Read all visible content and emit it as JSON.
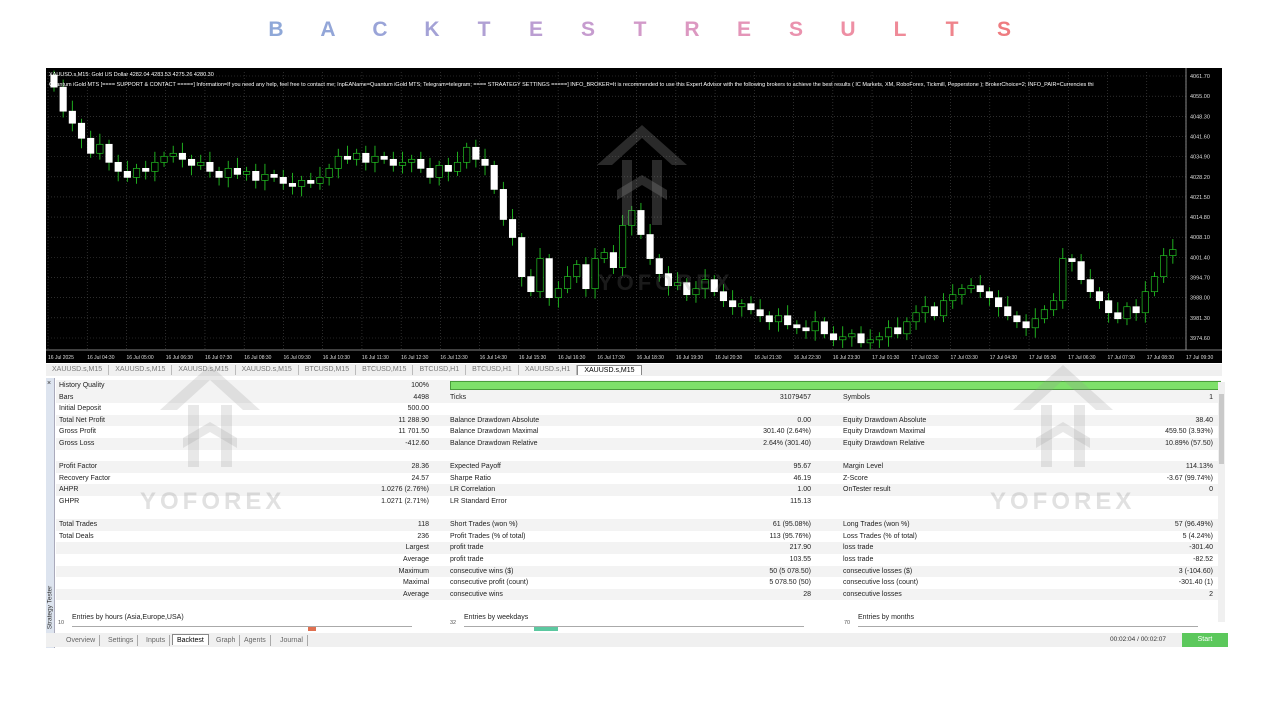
{
  "title": {
    "letters": [
      "B",
      "A",
      "C",
      "K",
      "T",
      "E",
      "S",
      "T",
      "R",
      "E",
      "S",
      "U",
      "L",
      "T",
      "S"
    ],
    "colors": [
      "#8fa8d8",
      "#93a6d8",
      "#9aa4d8",
      "#a4a2d6",
      "#b0a0d4",
      "#bb9ed2",
      "#c69ccf",
      "#d29ac9",
      "#dc98c1",
      "#e495b8",
      "#ea92ae",
      "#ee8fa4",
      "#ef8a98",
      "#ef848c",
      "#ee7c80"
    ]
  },
  "chart": {
    "header_line1": "XAUUSD.s,M15:  Gold US Dollar  4282.04 4283.53 4275.26 4280.30",
    "header_line2": "Quantum iGold MTS [==== SUPPORT & CONTACT =====] Information=If you need any help, feel free to contact me; InpEAName=Quantum iGold MTS; Telegram=telegram; ==== STRAATEGY SETTINGS =====] INFO_BROKER=It is recommended to use this Expert Advisor with the following brokers to achieve the best results ( IC Markets, XM, RoboForex, Tickmill, Pepperstone ); BrokerChoice=2; INFO_PAIR=Currencies thi",
    "price_labels": [
      "4061.70",
      "4055.00",
      "4048.30",
      "4041.60",
      "4034.90",
      "4028.20",
      "4021.50",
      "4014.80",
      "4008.10",
      "4001.40",
      "3994.70",
      "3988.00",
      "3981.30",
      "3974.60"
    ],
    "time_labels": [
      "16 Jul 2025",
      "16 Jul 04:30",
      "16 Jul 05:00",
      "16 Jul 06:30",
      "16 Jul 07:30",
      "16 Jul 08:30",
      "16 Jul 09:30",
      "16 Jul 10:30",
      "16 Jul 11:30",
      "16 Jul 12:30",
      "16 Jul 13:30",
      "16 Jul 14:30",
      "16 Jul 15:30",
      "16 Jul 16:30",
      "16 Jul 17:30",
      "16 Jul 18:30",
      "16 Jul 19:30",
      "16 Jul 20:30",
      "16 Jul 21:30",
      "16 Jul 22:30",
      "16 Jul 23:30",
      "17 Jul 01:30",
      "17 Jul 02:30",
      "17 Jul 03:30",
      "17 Jul 04:30",
      "17 Jul 05:30",
      "17 Jul 06:30",
      "17 Jul 07:30",
      "17 Jul 08:30",
      "17 Jul 09:30"
    ],
    "closes": [
      4058,
      4050,
      4046,
      4041,
      4036,
      4039,
      4033,
      4030,
      4028,
      4031,
      4030,
      4033,
      4035,
      4036,
      4034,
      4032,
      4033,
      4030,
      4028,
      4031,
      4029,
      4030,
      4027,
      4029,
      4028,
      4026,
      4025,
      4027,
      4026,
      4028,
      4031,
      4035,
      4034,
      4036,
      4033,
      4035,
      4034,
      4032,
      4033,
      4034,
      4031,
      4028,
      4032,
      4030,
      4033,
      4038,
      4034,
      4032,
      4024,
      4014,
      4008,
      3995,
      3990,
      4001,
      3988,
      3991,
      3995,
      3999,
      3991,
      4001,
      4003,
      3998,
      4012,
      4017,
      4009,
      4001,
      3996,
      3992,
      3993,
      3989,
      3991,
      3994,
      3990,
      3987,
      3985,
      3986,
      3984,
      3982,
      3980,
      3982,
      3979,
      3978,
      3977,
      3980,
      3976,
      3974,
      3975,
      3976,
      3973,
      3974,
      3975,
      3978,
      3976,
      3980,
      3983,
      3985,
      3982,
      3987,
      3989,
      3991,
      3992,
      3990,
      3988,
      3985,
      3982,
      3980,
      3978,
      3981,
      3984,
      3987,
      4001,
      4000,
      3994,
      3990,
      3987,
      3983,
      3981,
      3985,
      3983,
      3990,
      3995,
      4002,
      4004
    ]
  },
  "chart_tabs": [
    "XAUUSD.s,M15",
    "XAUUSD.s,M15",
    "XAUUSD.s,M15",
    "XAUUSD.s,M15",
    "BTCUSD,M15",
    "BTCUSD,M15",
    "BTCUSD,H1",
    "BTCUSD,H1",
    "XAUUSD.s,H1",
    "XAUUSD.s,M15"
  ],
  "report": {
    "rows": [
      {
        "shade": true,
        "a_label": "History Quality",
        "a_val": "100%",
        "b_label": "",
        "b_val": "",
        "c_label": "",
        "c_val": ""
      },
      {
        "shade": true,
        "a_label": "Bars",
        "a_val": "4498",
        "b_label": "Ticks",
        "b_val": "31079457",
        "c_label": "Symbols",
        "c_val": "1"
      },
      {
        "shade": false,
        "a_label": "Initial Deposit",
        "a_val": "500.00",
        "b_label": "",
        "b_val": "",
        "c_label": "",
        "c_val": ""
      },
      {
        "shade": true,
        "a_label": "Total Net Profit",
        "a_val": "11 288.90",
        "b_label": "Balance Drawdown Absolute",
        "b_val": "0.00",
        "c_label": "Equity Drawdown Absolute",
        "c_val": "38.40"
      },
      {
        "shade": false,
        "a_label": "Gross Profit",
        "a_val": "11 701.50",
        "b_label": "Balance Drawdown Maximal",
        "b_val": "301.40 (2.64%)",
        "c_label": "Equity Drawdown Maximal",
        "c_val": "459.50 (3.93%)"
      },
      {
        "shade": true,
        "a_label": "Gross Loss",
        "a_val": "-412.60",
        "b_label": "Balance Drawdown Relative",
        "b_val": "2.64% (301.40)",
        "c_label": "Equity Drawdown Relative",
        "c_val": "10.89% (57.50)"
      },
      {
        "shade": false,
        "a_label": "",
        "a_val": "",
        "b_label": "",
        "b_val": "",
        "c_label": "",
        "c_val": ""
      },
      {
        "shade": true,
        "a_label": "Profit Factor",
        "a_val": "28.36",
        "b_label": "Expected Payoff",
        "b_val": "95.67",
        "c_label": "Margin Level",
        "c_val": "114.13%"
      },
      {
        "shade": false,
        "a_label": "Recovery Factor",
        "a_val": "24.57",
        "b_label": "Sharpe Ratio",
        "b_val": "46.19",
        "c_label": "Z-Score",
        "c_val": "-3.67 (99.74%)"
      },
      {
        "shade": true,
        "a_label": "AHPR",
        "a_val": "1.0276 (2.76%)",
        "b_label": "LR Correlation",
        "b_val": "1.00",
        "c_label": "OnTester result",
        "c_val": "0"
      },
      {
        "shade": false,
        "a_label": "GHPR",
        "a_val": "1.0271 (2.71%)",
        "b_label": "LR Standard Error",
        "b_val": "115.13",
        "c_label": "",
        "c_val": ""
      },
      {
        "shade": false,
        "a_label": "",
        "a_val": "",
        "b_label": "",
        "b_val": "",
        "c_label": "",
        "c_val": ""
      },
      {
        "shade": true,
        "a_label": "Total Trades",
        "a_val": "118",
        "b_label": "Short Trades (won %)",
        "b_val": "61 (95.08%)",
        "c_label": "Long Trades (won %)",
        "c_val": "57 (96.49%)"
      },
      {
        "shade": false,
        "a_label": "Total Deals",
        "a_val": "236",
        "b_label": "Profit Trades (% of total)",
        "b_val": "113 (95.76%)",
        "c_label": "Loss Trades (% of total)",
        "c_val": "5 (4.24%)"
      },
      {
        "shade": true,
        "a_label": "",
        "a_val": "Largest",
        "b_label": "profit trade",
        "b_val": "217.90",
        "c_label": "loss trade",
        "c_val": "-301.40"
      },
      {
        "shade": false,
        "a_label": "",
        "a_val": "Average",
        "b_label": "profit trade",
        "b_val": "103.55",
        "c_label": "loss trade",
        "c_val": "-82.52"
      },
      {
        "shade": true,
        "a_label": "",
        "a_val": "Maximum",
        "b_label": "consecutive wins ($)",
        "b_val": "50 (5 078.50)",
        "c_label": "consecutive losses ($)",
        "c_val": "3 (-104.60)"
      },
      {
        "shade": false,
        "a_label": "",
        "a_val": "Maximal",
        "b_label": "consecutive profit (count)",
        "b_val": "5 078.50 (50)",
        "c_label": "consecutive loss (count)",
        "c_val": "-301.40 (1)"
      },
      {
        "shade": true,
        "a_label": "",
        "a_val": "Average",
        "b_label": "consecutive wins",
        "b_val": "28",
        "c_label": "consecutive losses",
        "c_val": "2"
      }
    ],
    "hist1_title": "Entries by hours (Asia,Europe,USA)",
    "hist1_num": "10",
    "hist2_title": "Entries by weekdays",
    "hist2_num": "32",
    "hist3_title": "Entries by months",
    "hist3_num": "70"
  },
  "side_label": "Strategy Tester",
  "close_glyph": "×",
  "bottom_tabs": [
    "Overview",
    "Settings",
    "Inputs",
    "Backtest",
    "Graph",
    "Agents",
    "Journal"
  ],
  "active_tab": "Backtest",
  "timer": "00:02:04 / 00:02:07",
  "start_label": "Start",
  "watermark_text": "YOFOREX"
}
